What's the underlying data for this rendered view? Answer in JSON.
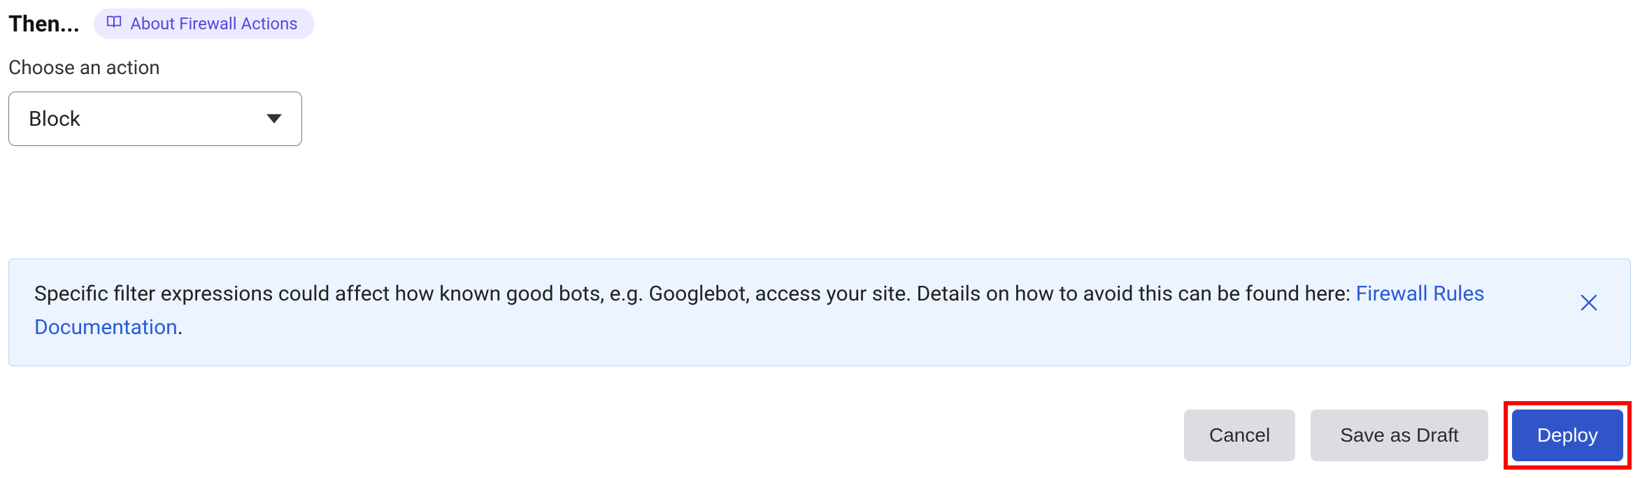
{
  "header": {
    "then_label": "Then...",
    "about_link_label": "About Firewall Actions"
  },
  "action": {
    "choose_label": "Choose an action",
    "selected_value": "Block"
  },
  "info_banner": {
    "text_before_link": "Specific filter expressions could affect how known good bots, e.g. Googlebot, access your site. Details on how to avoid this can be found here: ",
    "link_text": "Firewall Rules Documentation",
    "text_after_link": "."
  },
  "footer": {
    "cancel_label": "Cancel",
    "save_draft_label": "Save as Draft",
    "deploy_label": "Deploy"
  }
}
